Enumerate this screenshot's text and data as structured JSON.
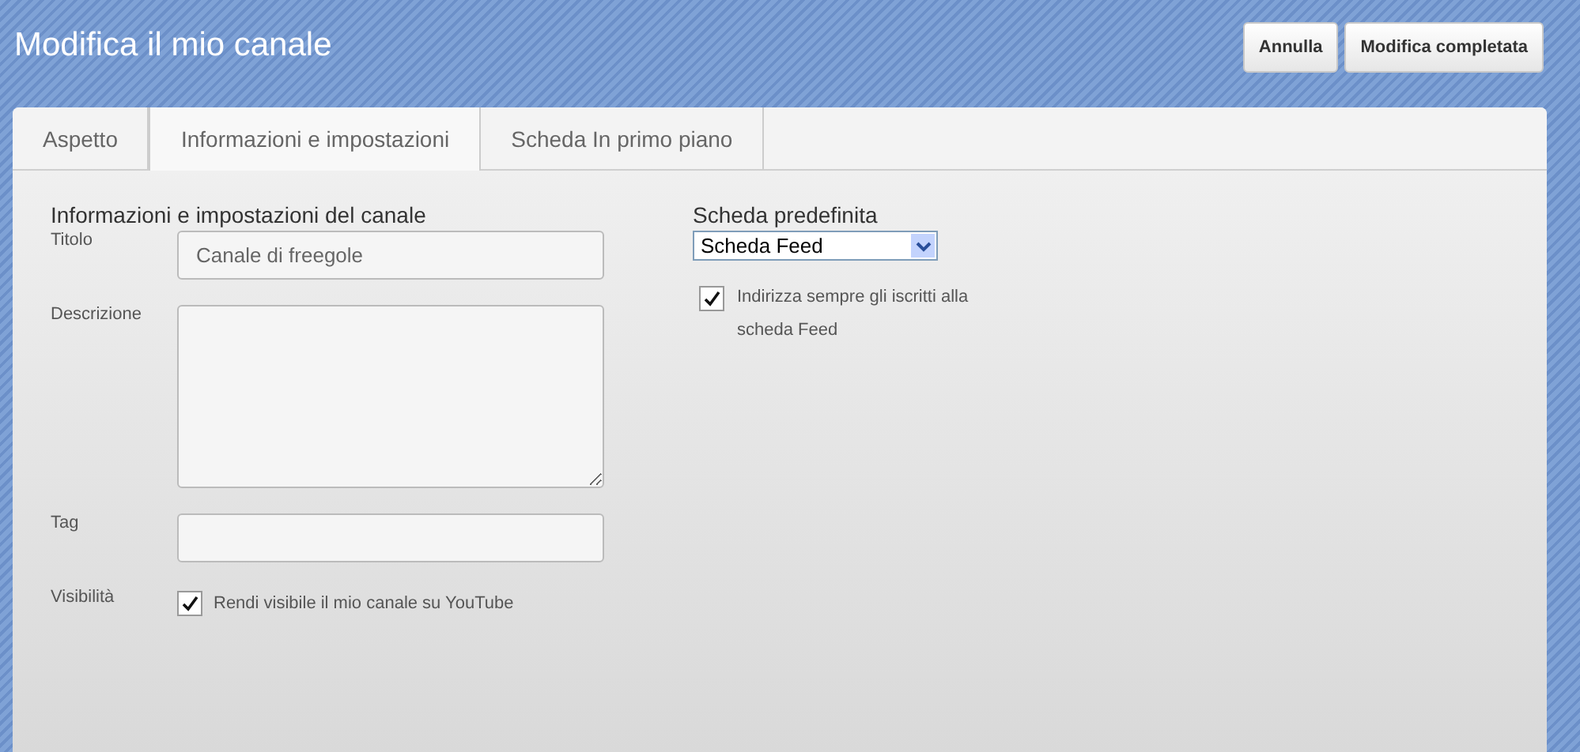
{
  "header": {
    "title": "Modifica il mio canale",
    "buttons": [
      "Annulla",
      "Modifica completata"
    ]
  },
  "tabs": [
    {
      "label": "Aspetto",
      "selected": false
    },
    {
      "label": "Informazioni e impostazioni",
      "selected": true
    },
    {
      "label": "Scheda In primo piano",
      "selected": false
    }
  ],
  "info": {
    "heading": "Informazioni e impostazioni del canale",
    "fields": [
      {
        "kind": "text",
        "label": "Titolo",
        "value": "Canale di freegole"
      },
      {
        "kind": "textarea",
        "label": "Descrizione"
      },
      {
        "kind": "text",
        "label": "Tag"
      },
      {
        "kind": "checkbox",
        "label": "Visibilità",
        "option": "Rendi visibile il mio canale su YouTube",
        "checked": true
      }
    ]
  },
  "default_tab": {
    "heading": "Scheda predefinita",
    "select": "Scheda Feed",
    "option": "Indirizza sempre gli iscritti alla scheda Feed",
    "checked": true
  }
}
